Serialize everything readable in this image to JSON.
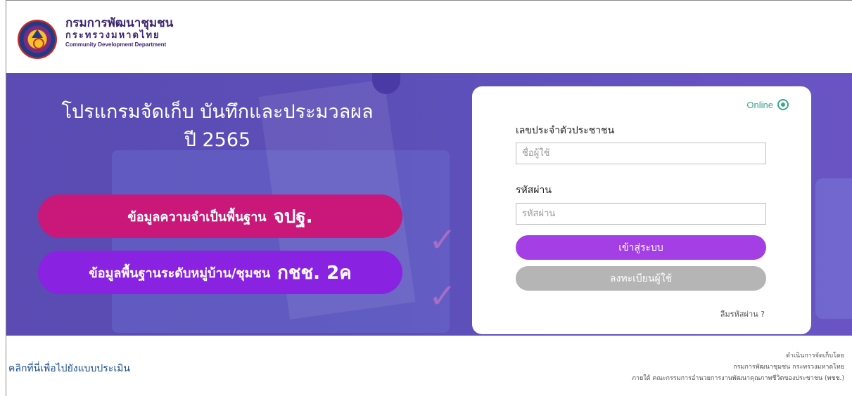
{
  "header": {
    "org_name_th": "กรมการพัฒนาชุมชน",
    "ministry_th": "กระทรวงมหาดไทย",
    "org_name_en": "Community Development Department"
  },
  "hero": {
    "title_line1": "โปรแกรมจัดเก็บ บันทึกและประมวลผล",
    "title_line2": "ปี 2565",
    "pill1_label": "ข้อมูลความจำเป็นพื้นฐาน",
    "pill1_emphasis": "จปฐ.",
    "pill2_label": "ข้อมูลพื้นฐานระดับหมู่บ้าน/ชุมชน",
    "pill2_emphasis": "กชช. 2ค"
  },
  "login": {
    "status": "Online",
    "id_label": "เลขประจำตัวประชาชน",
    "id_placeholder": "ชื่อผู้ใช้",
    "password_label": "รหัสผ่าน",
    "password_placeholder": "รหัสผ่าน",
    "login_button": "เข้าสู่ระบบ",
    "register_button": "ลงทะเบียนผู้ใช้",
    "forgot_link": "ลืมรหัสผ่าน ?"
  },
  "footer": {
    "eval_link": "คลิกที่นี่เพื่อไปยังแบบประเมิน",
    "credit_line1": "ดำเนินการจัดเก็บโดย",
    "credit_line2": "กรมการพัฒนาชุมชน กระทรวงมหาดไทย",
    "credit_line3": "ภายใต้ คณะกรรมการอำนวยการงานพัฒนาคุณภาพชีวิตของประชาชน (พชช.)"
  },
  "colors": {
    "hero_bg": "#5b4bb3",
    "pill1": "#c9177a",
    "pill2": "#8a22e2",
    "login_button": "#a33fe4",
    "register_button": "#b5b5b5",
    "online": "#3aa58c"
  }
}
